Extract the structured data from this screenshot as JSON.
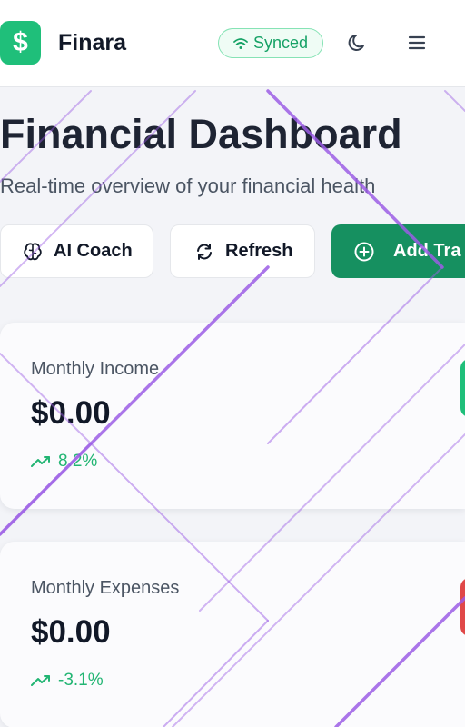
{
  "header": {
    "app_name": "Finara",
    "logo_symbol": "$",
    "sync_status": "Synced",
    "icons": [
      "dollar-icon",
      "wifi-icon",
      "moon-icon",
      "menu-icon"
    ]
  },
  "page": {
    "title": "Financial Dashboard",
    "subtitle": "Real-time overview of your financial health"
  },
  "actions": {
    "ai_coach": "AI Coach",
    "refresh": "Refresh",
    "add_transaction": "Add Tra"
  },
  "cards": [
    {
      "label": "Monthly Income",
      "value": "$0.00",
      "trend": "8.2%",
      "accent": "#1fbf7a"
    },
    {
      "label": "Monthly Expenses",
      "value": "$0.00",
      "trend": "-3.1%",
      "accent": "#e04848"
    }
  ],
  "colors": {
    "brand": "#1fbf7a",
    "primary_button": "#169060",
    "trend": "#22b573",
    "decoration": "#9b5de5"
  }
}
